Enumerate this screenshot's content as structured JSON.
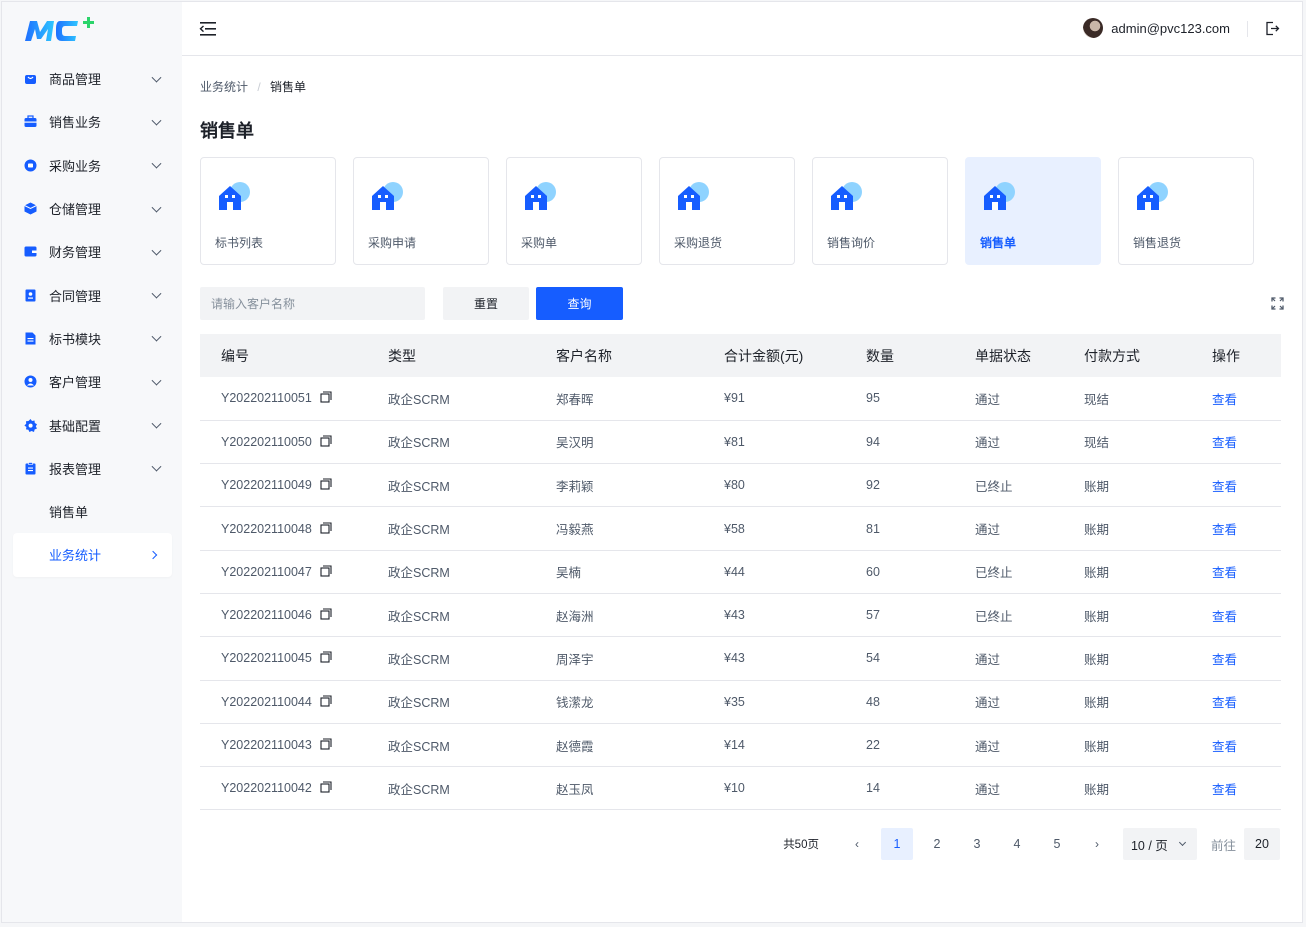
{
  "brand": {
    "logo_text": "MC+"
  },
  "sidebar": {
    "items": [
      {
        "label": "商品管理",
        "icon": "shopping-bag-icon"
      },
      {
        "label": "销售业务",
        "icon": "briefcase-icon"
      },
      {
        "label": "采购业务",
        "icon": "cart-icon"
      },
      {
        "label": "仓储管理",
        "icon": "cube-icon"
      },
      {
        "label": "财务管理",
        "icon": "wallet-icon"
      },
      {
        "label": "合同管理",
        "icon": "contract-icon"
      },
      {
        "label": "标书模块",
        "icon": "document-icon"
      },
      {
        "label": "客户管理",
        "icon": "user-icon"
      },
      {
        "label": "基础配置",
        "icon": "gear-icon"
      },
      {
        "label": "报表管理",
        "icon": "report-icon"
      }
    ],
    "sub_items": [
      {
        "label": "销售单"
      },
      {
        "label": "业务统计"
      }
    ]
  },
  "header": {
    "user_email": "admin@pvc123.com"
  },
  "breadcrumb": {
    "parent": "业务统计",
    "separator": "/",
    "current": "销售单"
  },
  "page": {
    "title": "销售单"
  },
  "cards": [
    {
      "label": "标书列表"
    },
    {
      "label": "采购申请"
    },
    {
      "label": "采购单"
    },
    {
      "label": "采购退货"
    },
    {
      "label": "销售询价"
    },
    {
      "label": "销售单"
    },
    {
      "label": "销售退货"
    }
  ],
  "search": {
    "placeholder": "请输入客户名称",
    "reset_label": "重置",
    "query_label": "查询"
  },
  "table": {
    "columns": [
      "编号",
      "类型",
      "客户名称",
      "合计金额(元)",
      "数量",
      "单据状态",
      "付款方式",
      "操作"
    ],
    "rows": [
      {
        "id": "Y202202110051",
        "type": "政企SCRM",
        "customer": "郑春晖",
        "amount": "¥91",
        "qty": "95",
        "status": "通过",
        "payment": "现结",
        "action": "查看"
      },
      {
        "id": "Y202202110050",
        "type": "政企SCRM",
        "customer": "吴汉明",
        "amount": "¥81",
        "qty": "94",
        "status": "通过",
        "payment": "现结",
        "action": "查看"
      },
      {
        "id": "Y202202110049",
        "type": "政企SCRM",
        "customer": "李莉颖",
        "amount": "¥80",
        "qty": "92",
        "status": "已终止",
        "payment": "账期",
        "action": "查看"
      },
      {
        "id": "Y202202110048",
        "type": "政企SCRM",
        "customer": "冯毅燕",
        "amount": "¥58",
        "qty": "81",
        "status": "通过",
        "payment": "账期",
        "action": "查看"
      },
      {
        "id": "Y202202110047",
        "type": "政企SCRM",
        "customer": "吴楠",
        "amount": "¥44",
        "qty": "60",
        "status": "已终止",
        "payment": "账期",
        "action": "查看"
      },
      {
        "id": "Y202202110046",
        "type": "政企SCRM",
        "customer": "赵海洲",
        "amount": "¥43",
        "qty": "57",
        "status": "已终止",
        "payment": "账期",
        "action": "查看"
      },
      {
        "id": "Y202202110045",
        "type": "政企SCRM",
        "customer": "周泽宇",
        "amount": "¥43",
        "qty": "54",
        "status": "通过",
        "payment": "账期",
        "action": "查看"
      },
      {
        "id": "Y202202110044",
        "type": "政企SCRM",
        "customer": "钱潆龙",
        "amount": "¥35",
        "qty": "48",
        "status": "通过",
        "payment": "账期",
        "action": "查看"
      },
      {
        "id": "Y202202110043",
        "type": "政企SCRM",
        "customer": "赵德霞",
        "amount": "¥14",
        "qty": "22",
        "status": "通过",
        "payment": "账期",
        "action": "查看"
      },
      {
        "id": "Y202202110042",
        "type": "政企SCRM",
        "customer": "赵玉凤",
        "amount": "¥10",
        "qty": "14",
        "status": "通过",
        "payment": "账期",
        "action": "查看"
      }
    ]
  },
  "pagination": {
    "total_label": "共50页",
    "prev": "‹",
    "next": "›",
    "pages": [
      "1",
      "2",
      "3",
      "4",
      "5"
    ],
    "page_size": "10 / 页",
    "goto_label": "前往",
    "goto_value": "20"
  },
  "colors": {
    "primary": "#165dff",
    "card_active_bg": "#e8f0ff",
    "icon_blue": "#165dff",
    "icon_light": "#8fd3ff"
  }
}
